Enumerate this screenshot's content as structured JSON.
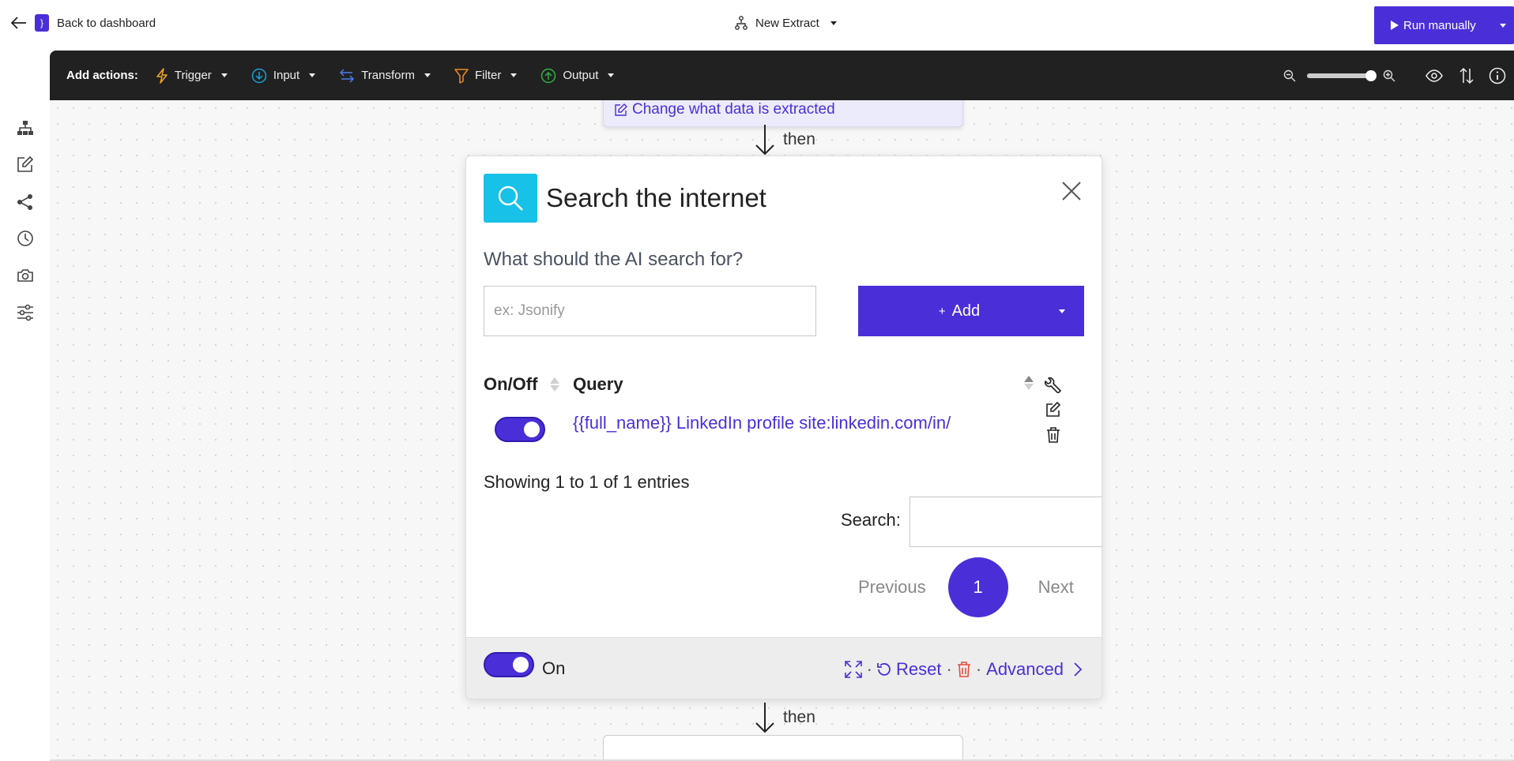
{
  "header": {
    "back_label": "Back to dashboard",
    "logo_glyph": "}",
    "workflow_name": "New Extract",
    "run_label": "Run manually"
  },
  "toolbar": {
    "add_actions_label": "Add actions:",
    "items": [
      {
        "label": "Trigger",
        "icon": "lightning-icon",
        "color": "#f5a623"
      },
      {
        "label": "Input",
        "icon": "arrow-down-circle-icon",
        "color": "#17a2d8"
      },
      {
        "label": "Transform",
        "icon": "swap-arrows-icon",
        "color": "#4a7cf0"
      },
      {
        "label": "Filter",
        "icon": "funnel-icon",
        "color": "#f08a24"
      },
      {
        "label": "Output",
        "icon": "arrow-up-circle-icon",
        "color": "#2fb344"
      }
    ]
  },
  "canvas": {
    "prev_node_link": "Change what data is extracted",
    "then_label": "then"
  },
  "card": {
    "title": "Search the internet",
    "question": "What should the AI search for?",
    "input_placeholder": "ex: Jsonify",
    "add_button": "Add",
    "add_prefix": "+",
    "table": {
      "col_onoff": "On/Off",
      "col_query": "Query",
      "rows": [
        {
          "enabled": true,
          "query": "{{full_name}} LinkedIn profile site:linkedin.com/in/"
        }
      ]
    },
    "entries_info": "Showing 1 to 1 of 1 entries",
    "search_label": "Search:",
    "pager": {
      "previous": "Previous",
      "current": "1",
      "next": "Next"
    },
    "footer": {
      "on_label": "On",
      "reset": "Reset",
      "advanced": "Advanced",
      "separator": "·"
    }
  },
  "colors": {
    "accent": "#4a2fd8",
    "search_icon_bg": "#17c1e8",
    "toolbar_bg": "#212121"
  }
}
